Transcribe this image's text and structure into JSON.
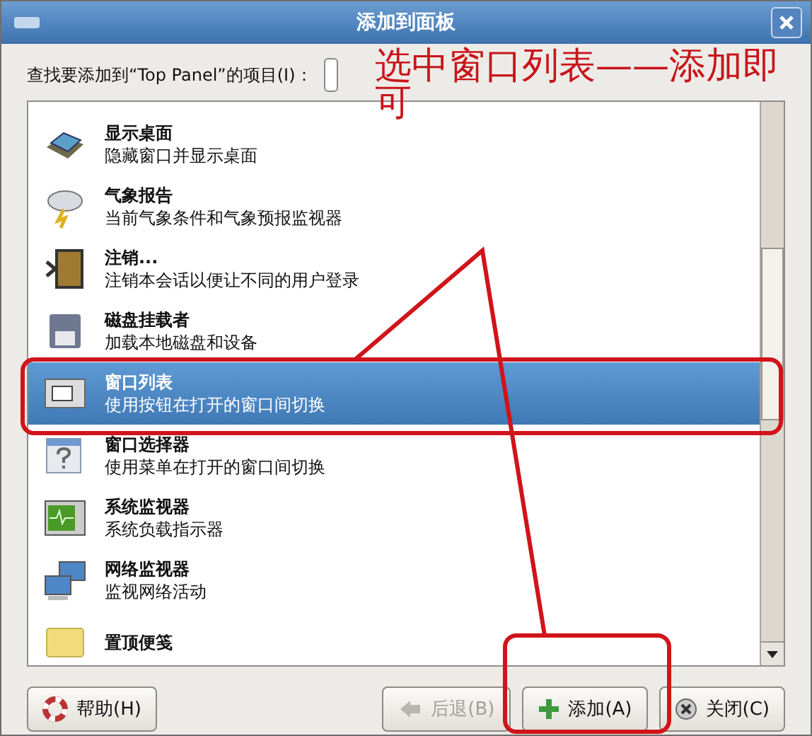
{
  "window": {
    "title": "添加到面板"
  },
  "search": {
    "label": "查找要添加到“Top Panel”的项目(I)："
  },
  "items": [
    {
      "title": "显示桌面",
      "description": "隐藏窗口并显示桌面",
      "selected": false
    },
    {
      "title": "气象报告",
      "description": "当前气象条件和气象预报监视器",
      "selected": false
    },
    {
      "title": "注销...",
      "description": "注销本会话以便让不同的用户登录",
      "selected": false
    },
    {
      "title": "磁盘挂载者",
      "description": "加载本地磁盘和设备",
      "selected": false
    },
    {
      "title": "窗口列表",
      "description": "使用按钮在打开的窗口间切换",
      "selected": true
    },
    {
      "title": "窗口选择器",
      "description": "使用菜单在打开的窗口间切换",
      "selected": false
    },
    {
      "title": "系统监视器",
      "description": "系统负载指示器",
      "selected": false
    },
    {
      "title": "网络监视器",
      "description": "监视网络活动",
      "selected": false
    },
    {
      "title": "置顶便笺",
      "selected": false
    }
  ],
  "buttons": [
    {
      "label": "帮助(H)",
      "kind": "help",
      "disabled": false
    },
    {
      "label": "后退(B)",
      "kind": "back",
      "disabled": true
    },
    {
      "label": "添加(A)",
      "kind": "add",
      "disabled": false
    },
    {
      "label": "关闭(C)",
      "kind": "close",
      "disabled": false
    }
  ],
  "annotation": {
    "text": "选中窗口列表——添加即可"
  }
}
